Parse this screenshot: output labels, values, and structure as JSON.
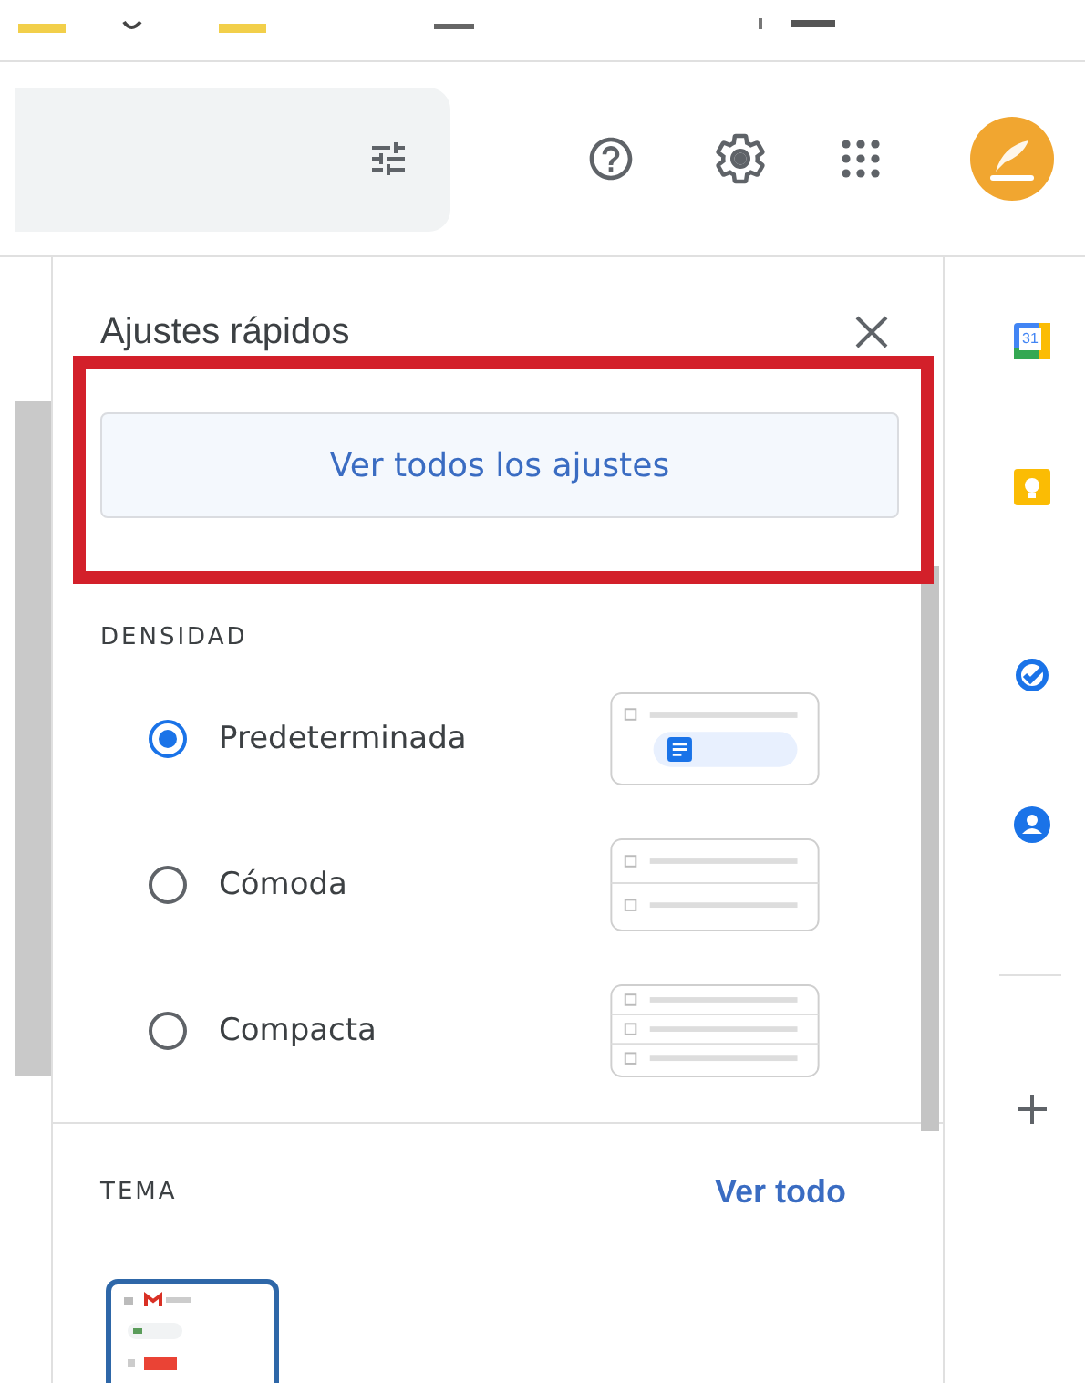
{
  "quick_settings": {
    "title": "Ajustes rápidos",
    "all_settings_button": "Ver todos los ajustes",
    "highlighted": true,
    "density": {
      "heading": "DENSIDAD",
      "options": [
        {
          "label": "Predeterminada",
          "selected": true,
          "kind": "default"
        },
        {
          "label": "Cómoda",
          "selected": false,
          "kind": "comfortable"
        },
        {
          "label": "Compacta",
          "selected": false,
          "kind": "compact"
        }
      ]
    },
    "theme": {
      "heading": "TEMA",
      "link": "Ver todo"
    }
  },
  "side_panel": {
    "calendar_day": "31"
  }
}
